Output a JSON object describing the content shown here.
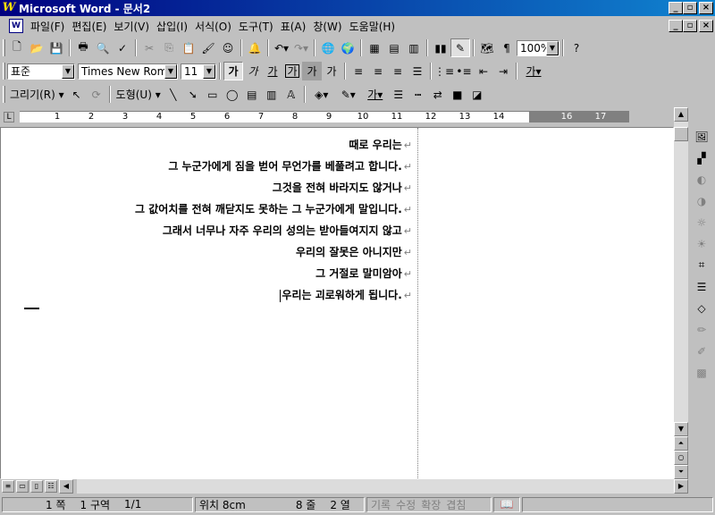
{
  "window": {
    "title": "Microsoft Word - 문서2",
    "app_icon": "W"
  },
  "caption_buttons": {
    "minimize": "_",
    "restore": "▫",
    "close": "×"
  },
  "menu": [
    "파일(F)",
    "편집(E)",
    "보기(V)",
    "삽입(I)",
    "서식(O)",
    "도구(T)",
    "표(A)",
    "창(W)",
    "도움말(H)"
  ],
  "standard_toolbar": {
    "zoom": "100%"
  },
  "formatting_toolbar": {
    "style": "표준",
    "font": "Times New Rom",
    "size": "11",
    "bold": "가",
    "italic": "가",
    "underline": "가",
    "box": "가",
    "shade": "가",
    "scale": "가"
  },
  "drawing_toolbar": {
    "draw_label": "그리기(R)",
    "autoshape_label": "도형(U)"
  },
  "ruler": {
    "numbers": [
      "1",
      "2",
      "3",
      "4",
      "5",
      "6",
      "7",
      "8",
      "9",
      "10",
      "11",
      "12",
      "13",
      "14",
      "16",
      "17"
    ]
  },
  "document": {
    "lines": [
      "때로 우리는",
      "그 누군가에게 짐을 벋어 무언가를 베풀려고 합니다.",
      "그것을 전혀 바라지도 않거나",
      "그 값어치를 전혀 깨닫지도 못하는 그 누군가에게 말입니다.",
      "그래서 너무나 자주 우리의 성의는 받아들여지지 않고",
      "우리의 잘못은 아니지만",
      "그 거절로 말미암아",
      "우리는 괴로워하게 됩니다."
    ],
    "paragraph_mark": "↵"
  },
  "status": {
    "page": "1 쪽",
    "section": "1 구역",
    "page_of": "1/1",
    "position": "위치 8cm",
    "line": "8 줄",
    "column": "2 열",
    "rec": "기록",
    "trk": "수정",
    "ext": "확장",
    "ovr": "겹침"
  }
}
